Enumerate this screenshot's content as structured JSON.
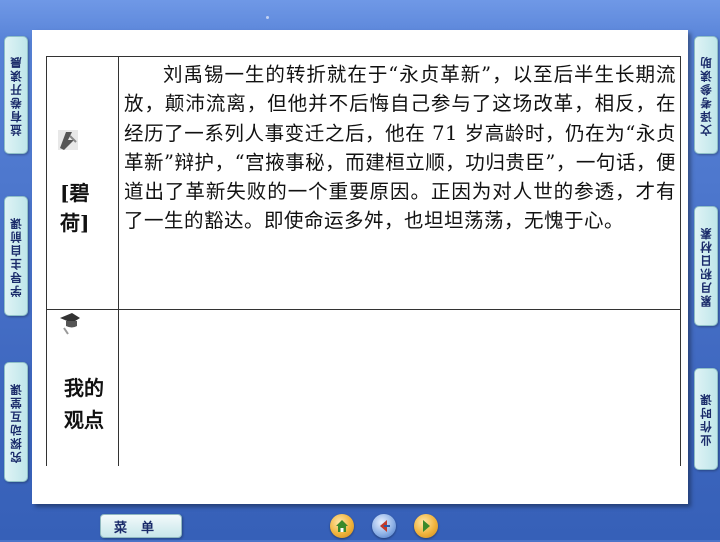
{
  "left_tabs": [
    {
      "label": "益有卷开读晨"
    },
    {
      "label": "学导主自前课"
    },
    {
      "label": "究探动互堂课"
    }
  ],
  "right_tabs": [
    {
      "label": "文译考参读助"
    },
    {
      "label": "累月积日材素"
    },
    {
      "label": "业作时课"
    }
  ],
  "table": {
    "row1_label": "[碧荷]",
    "row1_text": "刘禹锡一生的转折就在于“永贞革新”，以至后半生长期流放，颠沛流离，但他并不后悔自己参与了这场改革，相反，在经历了一系列人事变迁之后，他在 71 岁高龄时，仍在为“永贞革新”辩护，“宫掖事秘，而建桓立顺，功归贵臣”，一句话，便道出了革新失败的一个重要原因。正因为对人世的参透，才有了一生的豁达。即使命运多舛，也坦坦荡荡，无愧于心。",
    "row2_label": "我的观点",
    "row2_text": ""
  },
  "bottom_bar": {
    "menu_label": "菜单",
    "buttons": [
      {
        "icon": "home-icon",
        "color": "#e8a13a"
      },
      {
        "icon": "back-icon",
        "color": "#4a7fd0"
      },
      {
        "icon": "forward-icon",
        "color": "#e8a13a"
      }
    ]
  }
}
